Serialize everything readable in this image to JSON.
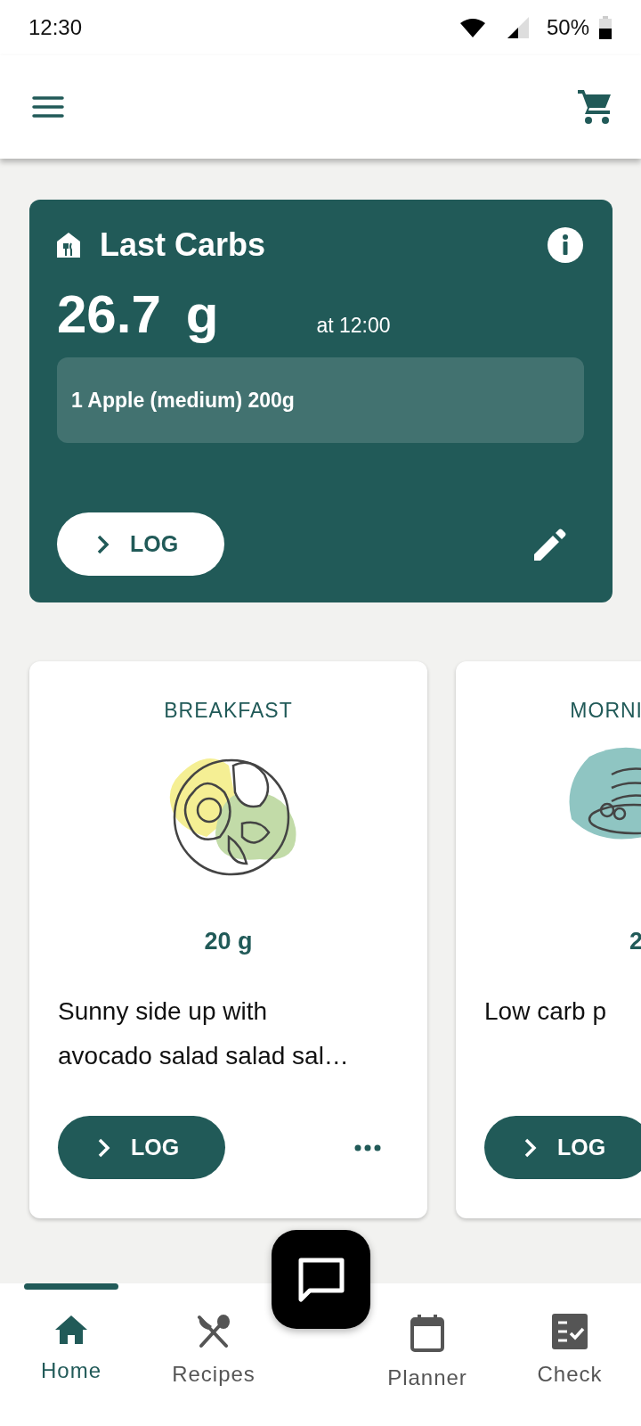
{
  "status_bar": {
    "time": "12:30",
    "battery": "50%"
  },
  "last_carbs": {
    "title": "Last Carbs",
    "amount": "26.7",
    "unit": "g",
    "time": "at 12:00",
    "food": "1 Apple (medium) 200g",
    "log_button": "LOG"
  },
  "meals": [
    {
      "kind": "full",
      "title": "BREAKFAST",
      "carbs": "20 g",
      "description": "Sunny side up with avocado salad salad sal…",
      "log_button": "LOG"
    },
    {
      "kind": "partial",
      "title": "MORNI",
      "carbs": "2",
      "description": "Low carb p",
      "log_button": "LOG"
    }
  ],
  "nav": [
    {
      "label": "Home",
      "selected": true
    },
    {
      "label": "Recipes",
      "selected": false
    },
    {
      "label": "Planner",
      "selected": false
    },
    {
      "label": "Check",
      "selected": false
    }
  ]
}
